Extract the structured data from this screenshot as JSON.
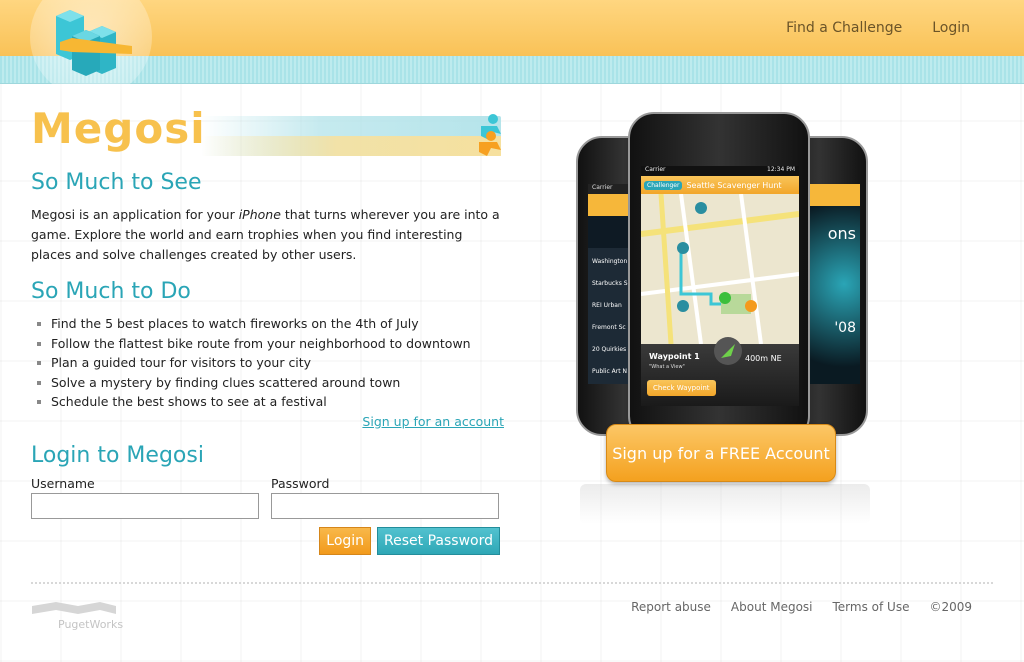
{
  "nav": {
    "find_challenge": "Find a Challenge",
    "login": "Login"
  },
  "brand": {
    "name": "Megosi"
  },
  "section_see": {
    "title": "So Much to See",
    "intro_prefix": "Megosi is an application for your ",
    "intro_em": "iPhone",
    "intro_suffix": " that turns wherever you are into a game. Explore the world and earn trophies when you find interesting places and solve challenges created by other users."
  },
  "section_do": {
    "title": "So Much to Do",
    "items": [
      "Find the 5 best places to watch fireworks on the 4th of July",
      "Follow the flattest bike route from your neighborhood to downtown",
      "Plan a guided tour for visitors to your city",
      "Solve a mystery by finding clues scattered around town",
      "Schedule the best shows to see at a festival"
    ],
    "signup_link": "Sign up for an account"
  },
  "login": {
    "title": "Login to Megosi",
    "username_label": "Username",
    "username_value": "",
    "password_label": "Password",
    "password_value": "",
    "login_button": "Login",
    "reset_button": "Reset Password"
  },
  "phone": {
    "carrier": "Carrier",
    "time": "12:34 PM",
    "back_button": "Challenger",
    "screen_title": "Seattle Scavenger Hunt",
    "waypoint_title": "Waypoint 1",
    "waypoint_subtitle": "\"What a View\"",
    "waypoint_distance": "400m NE",
    "check_button": "Check Waypoint",
    "left_phone_items": [
      "Washington",
      "Starbucks S",
      "REI Urban",
      "Fremont Sc",
      "20 Quirkies",
      "Public Art N"
    ],
    "right_phone_text": "'08",
    "right_phone_partial": "ons"
  },
  "cta": {
    "label": "Sign up for a FREE Account"
  },
  "footer": {
    "company": "PugetWorks",
    "links": [
      "Report abuse",
      "About Megosi",
      "Terms of Use"
    ],
    "copyright": "©2009"
  },
  "colors": {
    "accent_orange": "#f7c14d",
    "accent_teal": "#2aa5b6"
  }
}
